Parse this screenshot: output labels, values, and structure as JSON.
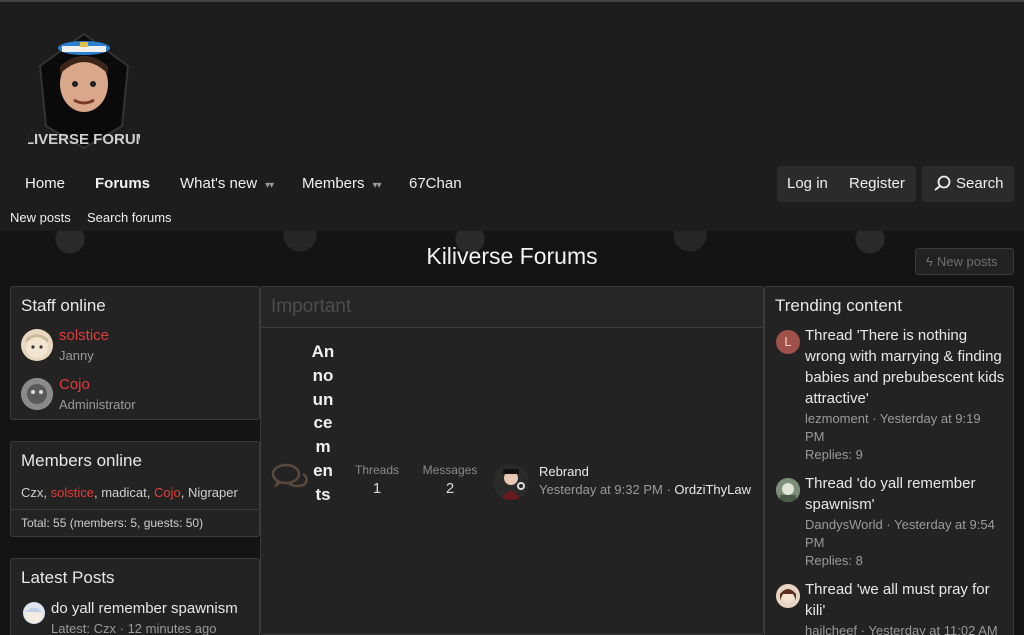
{
  "header": {
    "logo_text": "KILIVERSE FORUMS"
  },
  "nav": {
    "home": "Home",
    "forums": "Forums",
    "whats_new": "What's new",
    "members": "Members",
    "chan": "67Chan",
    "login": "Log in",
    "register": "Register",
    "search": "Search"
  },
  "subnav": {
    "new_posts": "New posts",
    "search_forums": "Search forums"
  },
  "page": {
    "title": "Kiliverse Forums",
    "new_posts_button": "New posts"
  },
  "staff_online": {
    "title": "Staff online",
    "members": [
      {
        "name": "solstice",
        "role": "Janny"
      },
      {
        "name": "Cojo",
        "role": "Administrator"
      }
    ]
  },
  "members_online": {
    "title": "Members online",
    "list": [
      {
        "name": "Czx",
        "color": "#e0e0e0"
      },
      {
        "name": "solstice",
        "color": "#e53b3b"
      },
      {
        "name": "madicat",
        "color": "#e0e0e0"
      },
      {
        "name": "Cojo",
        "color": "#e53b3b"
      },
      {
        "name": "Nigraper",
        "color": "#e0e0e0"
      }
    ],
    "separator": ", ",
    "total": "Total: 55 (members: 5, guests: 50)"
  },
  "latest_posts": {
    "title": "Latest Posts",
    "items": [
      {
        "title": "do yall remember spawnism",
        "meta": "Latest: Czx · 12 minutes ago"
      }
    ]
  },
  "category": {
    "title": "Important",
    "forum": {
      "name": "Announcements",
      "threads_label": "Threads",
      "threads": "1",
      "messages_label": "Messages",
      "messages": "2",
      "last_post_title": "Rebrand",
      "last_post_date": "Yesterday at 9:32 PM",
      "last_post_sep": "·",
      "last_post_user": "OrdziThyLaw"
    }
  },
  "trending": {
    "title": "Trending content",
    "items": [
      {
        "avatar_letter": "L",
        "avatar_color": "#a0524a",
        "title": "Thread 'There is nothing wrong with marrying & finding babies and prebubescent kids attractive'",
        "meta": "lezmoment · Yesterday at 9:19 PM",
        "replies": "Replies: 9"
      },
      {
        "avatar_letter": "",
        "avatar_color": "#6b7b6b",
        "title": "Thread 'do yall remember spawnism'",
        "meta": "DandysWorld · Yesterday at 9:54 PM",
        "replies": "Replies: 8"
      },
      {
        "avatar_letter": "",
        "avatar_color": "#8a5a4a",
        "title": "Thread 'we all must pray for kili'",
        "meta": "hailcheef · Yesterday at 11:02 AM",
        "replies": ""
      }
    ]
  },
  "colors": {
    "accent_red": "#e53b3b",
    "background": "#1b1b1b",
    "block": "#232323"
  }
}
